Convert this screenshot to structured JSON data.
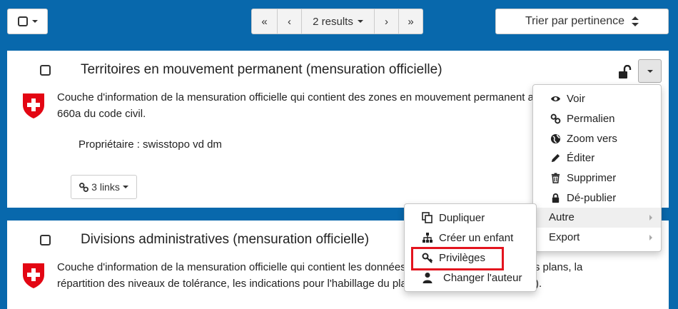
{
  "toolbar": {
    "select_all_icon": "checkbox-icon",
    "pager": {
      "first": "«",
      "prev": "‹",
      "results": "2 results",
      "next": "›",
      "last": "»"
    },
    "sort_label": "Trier par pertinence"
  },
  "records": [
    {
      "title": "Territoires en mouvement permanent (mensuration officielle)",
      "description_line1": "Couche d'information de la mensuration officielle qui contient des zones en mouvement permanent au sens de l'article",
      "description_line2": "660a du code civil.",
      "owner_label": "Propriétaire : ",
      "owner": "swisstopo vd dm",
      "links_label": "3 links"
    },
    {
      "title": "Divisions administratives (mensuration officielle)",
      "description_line1": "Couche d'information de la mensuration officielle qui contient les données relatives à la répartition des plans, la",
      "description_line2": "répartition des niveaux de tolérance, les indications pour l'habillage du plan (inscription, coordonnées)."
    }
  ],
  "actions_menu": {
    "items": [
      "Voir",
      "Permalien",
      "Zoom vers",
      "Éditer",
      "Supprimer",
      "Dé-publier"
    ],
    "other": "Autre",
    "export": "Export"
  },
  "other_submenu": {
    "items": [
      "Dupliquer",
      "Créer un enfant",
      "Privilèges",
      "Changer l'auteur"
    ],
    "highlighted": "Privilèges"
  },
  "colors": {
    "background": "#0868ac",
    "highlight": "#e3141e",
    "swiss_red": "#e30613"
  }
}
